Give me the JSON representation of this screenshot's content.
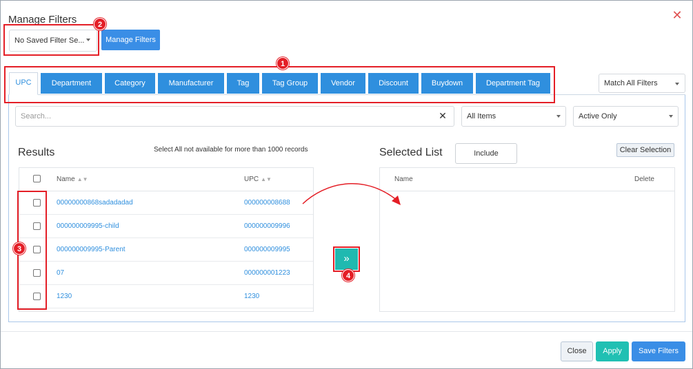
{
  "dialog": {
    "title": "Manage Filters"
  },
  "saved_filter": {
    "value": "No Saved Filter Se...",
    "manage_label": "Manage Filters"
  },
  "tabs": [
    {
      "label": "UPC"
    },
    {
      "label": "Department"
    },
    {
      "label": "Category"
    },
    {
      "label": "Manufacturer"
    },
    {
      "label": "Tag"
    },
    {
      "label": "Tag Group"
    },
    {
      "label": "Vendor"
    },
    {
      "label": "Discount"
    },
    {
      "label": "Buydown"
    },
    {
      "label": "Department Tag"
    }
  ],
  "match": {
    "value": "Match All Filters"
  },
  "search": {
    "placeholder": "Search...",
    "clear": "✕"
  },
  "items_select": {
    "value": "All Items"
  },
  "status_select": {
    "value": "Active Only"
  },
  "results": {
    "heading": "Results",
    "note": "Select All not available for more than 1000 records",
    "col_name": "Name",
    "col_upc": "UPC",
    "rows": [
      {
        "name": "00000000868sadadadad",
        "upc": "000000008688"
      },
      {
        "name": "000000009995-child",
        "upc": "000000009996"
      },
      {
        "name": "000000009995-Parent",
        "upc": "000000009995"
      },
      {
        "name": "07",
        "upc": "000000001223"
      },
      {
        "name": "1230",
        "upc": "1230"
      }
    ]
  },
  "move": {
    "label": "»"
  },
  "selected": {
    "heading": "Selected List",
    "include_label": "Include",
    "clear_label": "Clear Selection",
    "col_name": "Name",
    "col_delete": "Delete"
  },
  "badges": {
    "b1": "1",
    "b2": "2",
    "b3": "3",
    "b4": "4"
  },
  "footer": {
    "close": "Close",
    "apply": "Apply",
    "save": "Save Filters"
  },
  "colors": {
    "primary": "#2f8fde",
    "teal": "#20b9b0",
    "annotation": "#e41e26"
  }
}
